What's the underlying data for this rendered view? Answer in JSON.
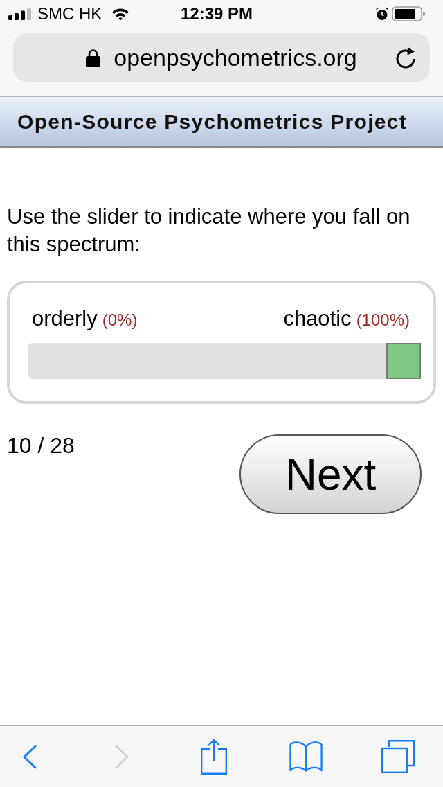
{
  "status_bar": {
    "carrier": "SMC HK",
    "time": "12:39 PM"
  },
  "address_bar": {
    "url": "openpsychometrics.org"
  },
  "header": {
    "title": "Open-Source Psychometrics Project"
  },
  "question": {
    "prompt": "Use the slider to indicate where you fall on this spectrum:"
  },
  "slider": {
    "left_label": "orderly",
    "left_value": "(0%)",
    "right_label": "chaotic",
    "right_value": "(100%)",
    "level": 1
  },
  "progress": {
    "text": "10 / 28"
  },
  "next_button": {
    "label": "Next"
  },
  "toolbar": {
    "items": [
      {
        "kind": "back",
        "disabled": false
      },
      {
        "kind": "forward",
        "disabled": true
      },
      {
        "kind": "share",
        "disabled": false
      },
      {
        "kind": "bookmarks",
        "disabled": false
      },
      {
        "kind": "tabs",
        "disabled": false
      }
    ]
  }
}
